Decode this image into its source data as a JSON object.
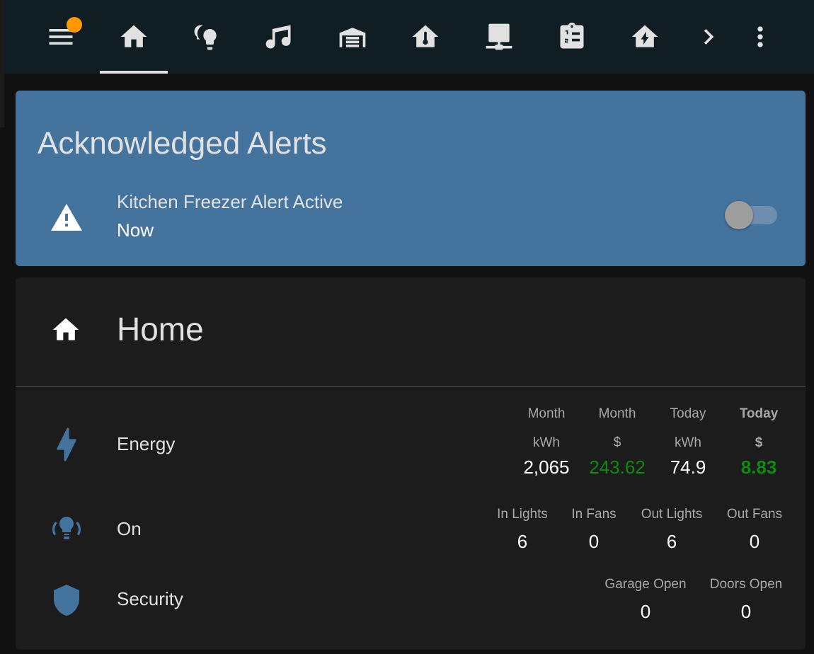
{
  "nav": {
    "items": [
      {
        "name": "menu-icon",
        "has_badge": true
      },
      {
        "name": "home-icon",
        "active": true
      },
      {
        "name": "lightbulb-group-icon"
      },
      {
        "name": "music-note-icon"
      },
      {
        "name": "garage-icon"
      },
      {
        "name": "home-thermometer-icon"
      },
      {
        "name": "server-network-icon"
      },
      {
        "name": "clipboard-list-icon"
      },
      {
        "name": "home-lightning-icon"
      },
      {
        "name": "chevron-right-icon"
      },
      {
        "name": "dots-vertical-icon"
      }
    ],
    "badge_color": "#ff9800"
  },
  "alerts": {
    "title": "Acknowledged Alerts",
    "item": {
      "icon": "alert-icon",
      "name": "Kitchen Freezer Alert Active",
      "time": "Now",
      "toggle_state": "off"
    },
    "card_color": "#44739e"
  },
  "home": {
    "title": "Home",
    "icon": "home-icon",
    "rows": {
      "energy": {
        "label": "Energy",
        "icon": "lightning-bolt-icon",
        "stats": [
          {
            "header1": "Month",
            "header2": "kWh",
            "value": "2,065",
            "color": "#ffffff"
          },
          {
            "header1": "Month",
            "header2": "$",
            "value": "243.62",
            "color": "#0f8a0f"
          },
          {
            "header1": "Today",
            "header2": "kWh",
            "value": "74.9",
            "color": "#ffffff"
          },
          {
            "header1": "Today",
            "header2": "$",
            "value": "8.83",
            "color": "#0f8a0f",
            "bold": true
          }
        ]
      },
      "lights": {
        "label": "On",
        "icon": "lightbulb-group-icon",
        "stats": [
          {
            "header": "In Lights",
            "value": "6"
          },
          {
            "header": "In Fans",
            "value": "0"
          },
          {
            "header": "Out Lights",
            "value": "6"
          },
          {
            "header": "Out Fans",
            "value": "0"
          }
        ]
      },
      "security": {
        "label": "Security",
        "icon": "shield-icon",
        "stats": [
          {
            "header": "Garage Open",
            "value": "0"
          },
          {
            "header": "Doors Open",
            "value": "0"
          }
        ]
      }
    },
    "accent_color": "#44739e"
  }
}
